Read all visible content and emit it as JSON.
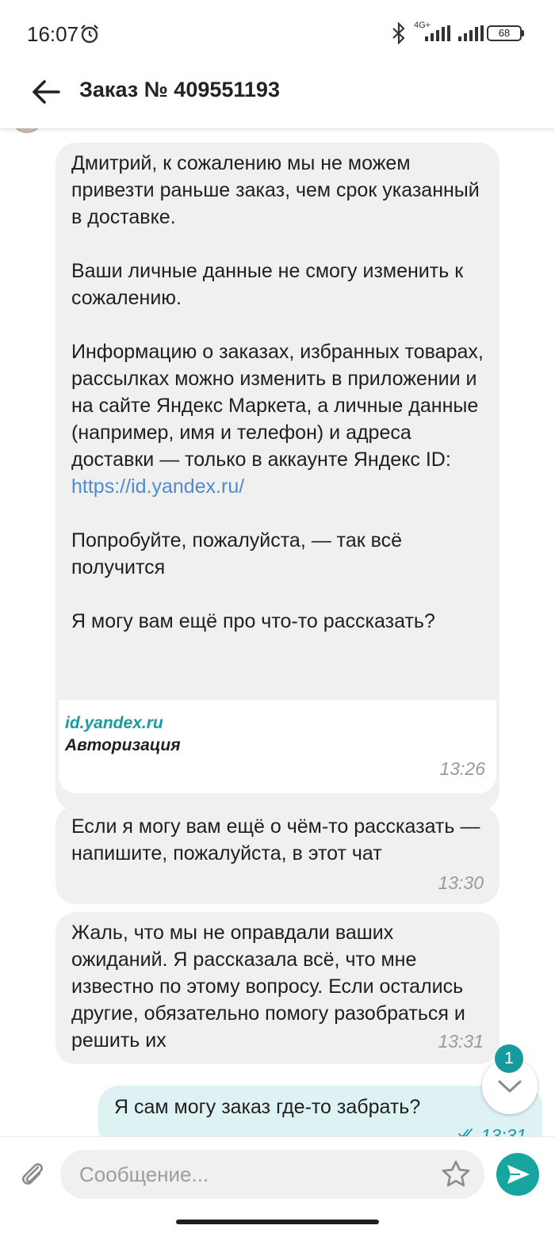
{
  "status_bar": {
    "time": "16:07",
    "network_label": "4G+",
    "battery": "68",
    "icons": [
      "alarm-icon",
      "bluetooth-icon",
      "signal-icon",
      "battery-icon"
    ]
  },
  "header": {
    "title": "Заказ № 409551193",
    "back_icon": "arrow-left-icon"
  },
  "messages": {
    "m1": {
      "para1": "Дмитрий, к сожалению мы не можем привезти раньше заказ, чем срок указанный в доставке.",
      "para2": "Ваши личные данные не смогу изменить к сожалению.",
      "para3": "Информацию о заказах, избранных товарах, рассылках можно изменить в приложении и на сайте Яндекс Маркета, а личные данные (например, имя и телефон) и адреса доставки — только в аккаунте Яндекс ID:",
      "link": "https://id.yandex.ru/",
      "para4": "Попробуйте, пожалуйста, — так всё получится",
      "para5": "Я могу вам ещё про что-то рассказать?",
      "preview_domain": "id.yandex.ru",
      "preview_title": "Авторизация",
      "time": "13:26"
    },
    "m2": {
      "text": "Если я могу вам ещё о чём-то рассказать — напишите, пожалуйста, в этот чат",
      "time": "13:30"
    },
    "m3": {
      "text": "Жаль, что мы не оправдали ваших ожиданий. Я рассказала всё, что мне известно по этому вопросу. Если остались другие, обязательно помогу разобраться и решить их",
      "time": "13:31"
    },
    "outgoing": {
      "text": "Я сам могу заказ где-то забрать?",
      "time": "13:31",
      "status_icon": "double-check-icon"
    }
  },
  "scroll_button": {
    "unread_count": "1",
    "icon": "chevron-down-icon"
  },
  "composer": {
    "placeholder": "Сообщение...",
    "value": "",
    "icons": [
      "paperclip-icon",
      "star-icon",
      "send-icon"
    ]
  },
  "colors": {
    "accent": "#17a5a0",
    "incoming_bubble": "#f0f0f0",
    "outgoing_bubble": "#dff2f3",
    "link": "#4f8bd0"
  }
}
